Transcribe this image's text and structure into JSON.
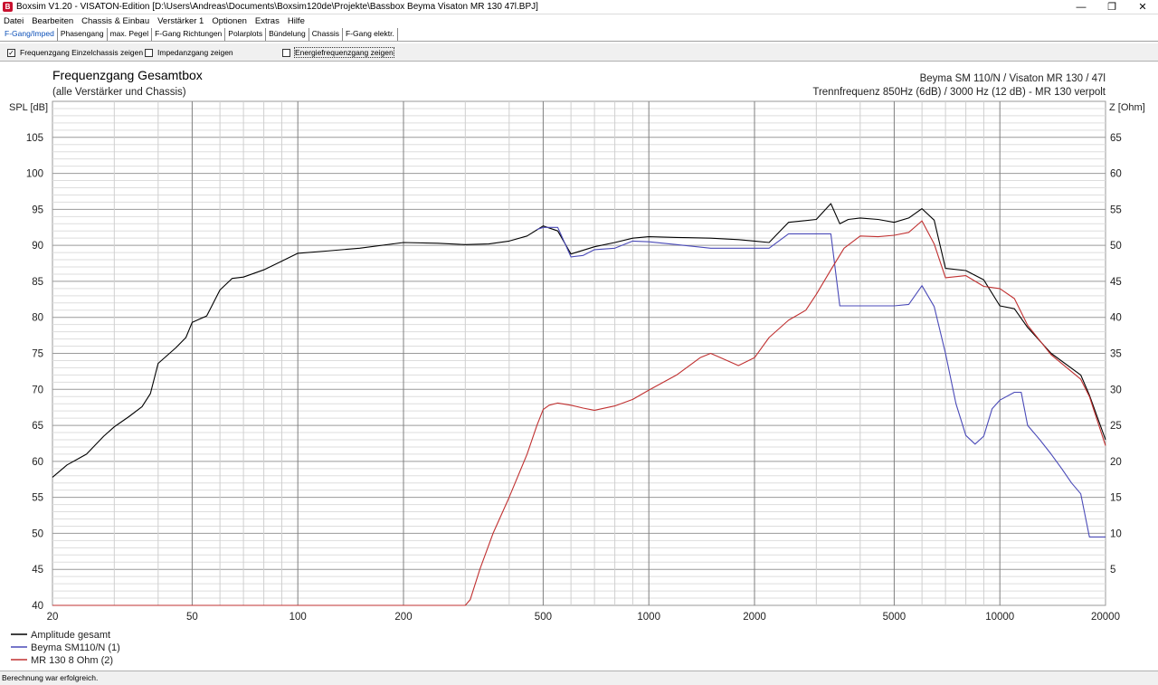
{
  "window": {
    "title": "Boxsim V1.20 - VISATON-Edition [D:\\Users\\Andreas\\Documents\\Boxsim120de\\Projekte\\Bassbox Beyma Visaton MR 130 47l.BPJ]",
    "app_icon": "boxsim-app-icon",
    "controls": [
      "minimize-icon",
      "maximize-icon",
      "close-icon"
    ]
  },
  "menu": [
    "Datei",
    "Bearbeiten",
    "Chassis & Einbau",
    "Verstärker 1",
    "Optionen",
    "Extras",
    "Hilfe"
  ],
  "tabs": [
    {
      "label": "F-Gang/Imped",
      "active": true
    },
    {
      "label": "Phasengang",
      "active": false
    },
    {
      "label": "max. Pegel",
      "active": false
    },
    {
      "label": "F-Gang Richtungen",
      "active": false
    },
    {
      "label": "Polarplots",
      "active": false
    },
    {
      "label": "Bündelung",
      "active": false
    },
    {
      "label": "Chassis",
      "active": false
    },
    {
      "label": "F-Gang elektr.",
      "active": false
    }
  ],
  "options": [
    {
      "label": "Frequenzgang Einzelchassis zeigen",
      "checked": true
    },
    {
      "label": "Impedanzgang zeigen",
      "checked": false
    },
    {
      "label": "Energiefrequenzgang zeigen",
      "checked": false
    }
  ],
  "status": "Berechnung war erfolgreich.",
  "chart_data": {
    "type": "line",
    "title": "Frequenzgang Gesamtbox",
    "subtitle": "(alle Verstärker und Chassis)",
    "info_line1": "Beyma SM 110/N / Visaton MR 130 / 47l",
    "info_line2": "Trennfrequenz 850Hz (6dB) / 3000 Hz (12 dB) - MR 130 verpolt",
    "ylabel": "SPL [dB]",
    "y2label": "Z [Ohm]",
    "xscale": "log",
    "xlim": [
      20,
      20000
    ],
    "ylim": [
      40,
      110
    ],
    "y2lim": [
      0,
      70
    ],
    "grid": true,
    "legend_position": "bottom-left",
    "xticks": [
      20,
      50,
      100,
      200,
      500,
      1000,
      2000,
      5000,
      10000,
      20000
    ],
    "yticks": [
      40,
      45,
      50,
      55,
      60,
      65,
      70,
      75,
      80,
      85,
      90,
      95,
      100,
      105
    ],
    "y2ticks": [
      5,
      10,
      15,
      20,
      25,
      30,
      35,
      40,
      45,
      50,
      55,
      60,
      65
    ],
    "series": [
      {
        "name": "Amplitude gesamt",
        "color": "#000000",
        "x": [
          20,
          22,
          25,
          28,
          30,
          33,
          36,
          38,
          40,
          45,
          48,
          50,
          55,
          60,
          65,
          70,
          80,
          90,
          100,
          120,
          150,
          200,
          250,
          300,
          350,
          400,
          450,
          500,
          550,
          600,
          700,
          800,
          900,
          1000,
          1200,
          1500,
          1800,
          2000,
          2200,
          2500,
          3000,
          3300,
          3500,
          3700,
          4000,
          4500,
          5000,
          5500,
          6000,
          6500,
          7000,
          8000,
          9000,
          10000,
          11000,
          12000,
          14000,
          17000,
          18000,
          20000
        ],
        "y": [
          57.8,
          59.5,
          61.0,
          63.5,
          64.8,
          66.2,
          67.6,
          69.4,
          73.6,
          75.8,
          77.2,
          79.3,
          80.2,
          83.8,
          85.4,
          85.6,
          86.6,
          87.8,
          88.9,
          89.2,
          89.6,
          90.4,
          90.3,
          90.1,
          90.2,
          90.6,
          91.3,
          92.7,
          92.0,
          88.8,
          89.8,
          90.4,
          91.0,
          91.2,
          91.1,
          91.0,
          90.8,
          90.6,
          90.4,
          93.2,
          93.6,
          95.8,
          93.0,
          93.6,
          93.8,
          93.6,
          93.2,
          93.8,
          95.1,
          93.5,
          86.8,
          86.5,
          85.2,
          81.6,
          81.2,
          78.6,
          75.0,
          72.0,
          69.2,
          63.0
        ]
      },
      {
        "name": "Beyma SM110/N (1)",
        "color": "#4a4ab8",
        "x": [
          480,
          500,
          550,
          600,
          650,
          700,
          800,
          900,
          1000,
          1200,
          1500,
          1800,
          2000,
          2200,
          2500,
          3000,
          3300,
          3500,
          4000,
          4500,
          5000,
          5500,
          6000,
          6500,
          7000,
          7500,
          8000,
          8500,
          9000,
          9500,
          10000,
          11000,
          11500,
          12000,
          13000,
          14000,
          15000,
          16000,
          17000,
          18000,
          20000
        ],
        "y": [
          92.2,
          92.5,
          92.5,
          88.4,
          88.6,
          89.4,
          89.6,
          90.6,
          90.5,
          90.1,
          89.6,
          89.6,
          89.6,
          89.6,
          91.6,
          91.6,
          91.6,
          81.6,
          81.6,
          81.6,
          81.6,
          81.8,
          84.4,
          81.5,
          75.0,
          68.0,
          63.6,
          62.4,
          63.5,
          67.3,
          68.5,
          69.6,
          69.6,
          65.0,
          63.0,
          61.0,
          59.0,
          57.0,
          55.5,
          49.5,
          49.5
        ]
      },
      {
        "name": "MR 130 8 Ohm (2)",
        "color": "#c03030",
        "x": [
          20,
          100,
          200,
          250,
          300,
          310,
          330,
          360,
          400,
          450,
          480,
          500,
          520,
          550,
          600,
          650,
          700,
          800,
          900,
          1000,
          1200,
          1400,
          1500,
          1600,
          1800,
          2000,
          2200,
          2500,
          2800,
          3000,
          3300,
          3600,
          4000,
          4500,
          5000,
          5500,
          6000,
          6500,
          7000,
          8000,
          9000,
          10000,
          11000,
          12000,
          14000,
          17000,
          18000,
          20000
        ],
        "y": [
          40,
          40,
          40,
          40,
          40,
          40.8,
          45.0,
          50.0,
          55.0,
          61.0,
          65.0,
          67.2,
          67.8,
          68.1,
          67.8,
          67.4,
          67.1,
          67.7,
          68.6,
          69.9,
          72.0,
          74.4,
          75.0,
          74.4,
          73.3,
          74.4,
          77.2,
          79.6,
          81.0,
          83.2,
          86.6,
          89.6,
          91.3,
          91.2,
          91.4,
          91.8,
          93.4,
          90.2,
          85.5,
          85.8,
          84.3,
          84.0,
          82.6,
          78.9,
          74.8,
          71.4,
          69.0,
          62.2
        ]
      }
    ]
  }
}
